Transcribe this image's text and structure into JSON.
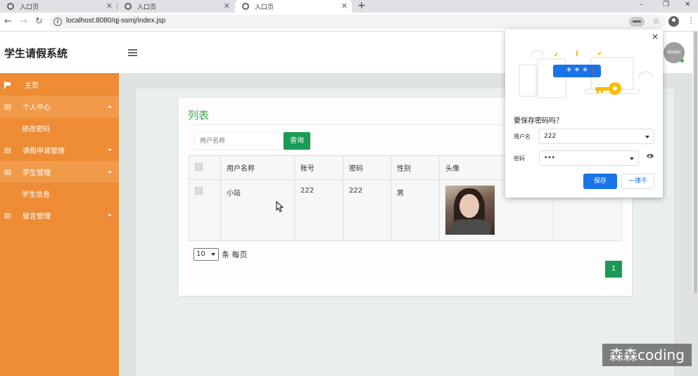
{
  "browser": {
    "tabs": [
      {
        "label": "入口页",
        "active": false
      },
      {
        "label": "入口页",
        "active": false
      },
      {
        "label": "入口页",
        "active": true
      }
    ],
    "new_tab": "+",
    "url": "localhost:8080/qj-ssmj/index.jsp",
    "window_controls": {
      "minimize": "–",
      "restore": "❐",
      "close": "✕"
    }
  },
  "header": {
    "title": "学生请假系统",
    "avatar_text": "80x80"
  },
  "sidebar": {
    "items": [
      {
        "label": "主页",
        "icon": "flag-icon"
      },
      {
        "label": "个人中心",
        "icon": "grid-icon"
      },
      {
        "label": "修改密码",
        "icon": ""
      },
      {
        "label": "请假申请管理",
        "icon": "grid-icon"
      },
      {
        "label": "学生管理",
        "icon": "grid-icon"
      },
      {
        "label": "学生信息",
        "icon": ""
      },
      {
        "label": "留言管理",
        "icon": "grid-icon"
      }
    ]
  },
  "main": {
    "card_title": "列表",
    "search": {
      "placeholder": "用户名称",
      "button": "查询"
    },
    "table": {
      "headers": [
        "",
        "用户名称",
        "账号",
        "密码",
        "性别",
        "头像",
        ""
      ],
      "rows": [
        {
          "name": "小站",
          "account": "222",
          "password": "222",
          "gender": "男",
          "avatar": "photo"
        }
      ]
    },
    "pagination": {
      "page_size": "10",
      "page_size_suffix": "条 每页",
      "current_page": "1"
    }
  },
  "password_popup": {
    "heading": "要保存密码吗？",
    "username_label": "用户名",
    "username_value": "222",
    "password_label": "密码",
    "password_value": "•••",
    "save_button": "保存",
    "never_button": "一律不",
    "close": "×",
    "illustration_text": "* * *"
  },
  "watermark": "森森coding",
  "colors": {
    "sidebar": "#ed8c34",
    "primary_green": "#1a9a55",
    "title_green": "#3eaa56",
    "chrome_blue": "#1a73e8"
  }
}
